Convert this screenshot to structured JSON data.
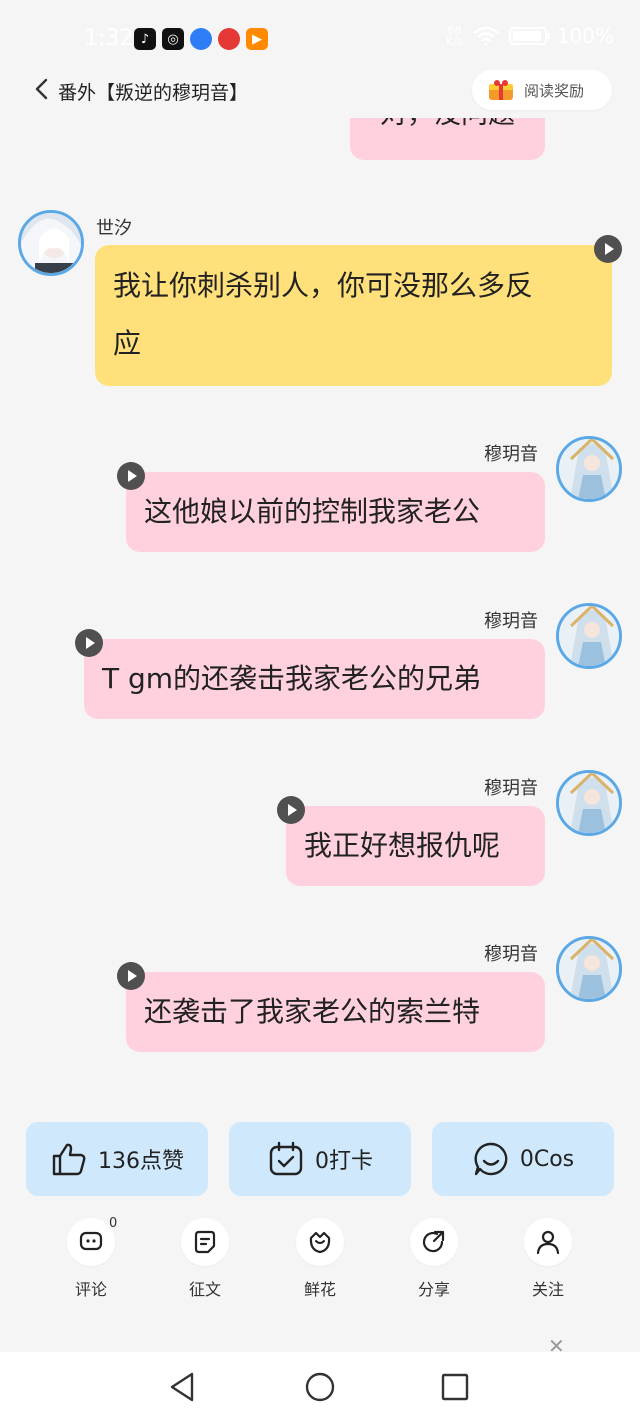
{
  "status_bar": {
    "time": "1:32",
    "net_speed_value": "68",
    "net_speed_unit": "K/s",
    "battery": "100%"
  },
  "header": {
    "back_icon": "chevron-left-icon",
    "title": "番外【叛逆的穆玥音】",
    "reward_label": "阅读奖励"
  },
  "chat": {
    "partial_message": "对，没问题",
    "messages": [
      {
        "sender": "世汐",
        "side": "left",
        "color": "#ffe07a",
        "lines": [
          "我让你刺杀别人，你可没那么多反",
          "应"
        ]
      },
      {
        "sender": "穆玥音",
        "side": "right",
        "color": "#ffd1de",
        "lines": [
          "这他娘以前的控制我家老公"
        ]
      },
      {
        "sender": "穆玥音",
        "side": "right",
        "color": "#ffd1de",
        "lines": [
          "T gm的还袭击我家老公的兄弟"
        ]
      },
      {
        "sender": "穆玥音",
        "side": "right",
        "color": "#ffd1de",
        "lines": [
          "我正好想报仇呢"
        ]
      },
      {
        "sender": "穆玥音",
        "side": "right",
        "color": "#ffd1de",
        "lines": [
          "还袭击了我家老公的索兰特"
        ]
      }
    ]
  },
  "actions": {
    "like": "136点赞",
    "checkin": "0打卡",
    "cos": "0Cos"
  },
  "tools": {
    "comment_count": "0",
    "items": [
      "评论",
      "征文",
      "鲜花",
      "分享",
      "关注"
    ]
  },
  "colors": {
    "accent_blue": "#cfe8fb",
    "pink_bubble": "#ffd1de",
    "yellow_bubble": "#ffe07a",
    "avatar_ring": "#5aa8e6"
  }
}
